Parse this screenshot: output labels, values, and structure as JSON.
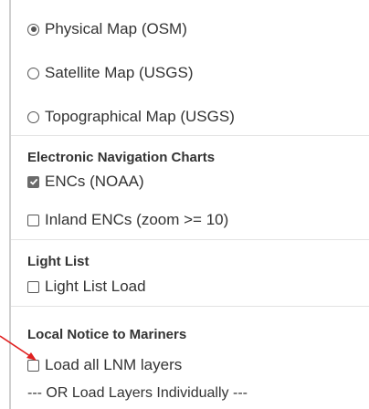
{
  "basemaps": [
    {
      "label": "Physical Map (OSM)",
      "selected": true
    },
    {
      "label": "Satellite Map (USGS)",
      "selected": false
    },
    {
      "label": "Topographical Map (USGS)",
      "selected": false
    }
  ],
  "enc": {
    "heading": "Electronic Navigation Charts",
    "items": [
      {
        "label": "ENCs (NOAA)",
        "checked": true
      },
      {
        "label": "Inland ENCs (zoom >= 10)",
        "checked": false
      }
    ]
  },
  "light_list": {
    "heading": "Light List",
    "items": [
      {
        "label": "Light List Load",
        "checked": false
      }
    ]
  },
  "lnm": {
    "heading": "Local Notice to Mariners",
    "items": [
      {
        "label": "Load all LNM layers",
        "checked": false
      }
    ],
    "individual_label": "--- OR Load Layers Individually ---"
  },
  "colors": {
    "arrow": "#e02020",
    "separator": "#e3e3e3"
  }
}
